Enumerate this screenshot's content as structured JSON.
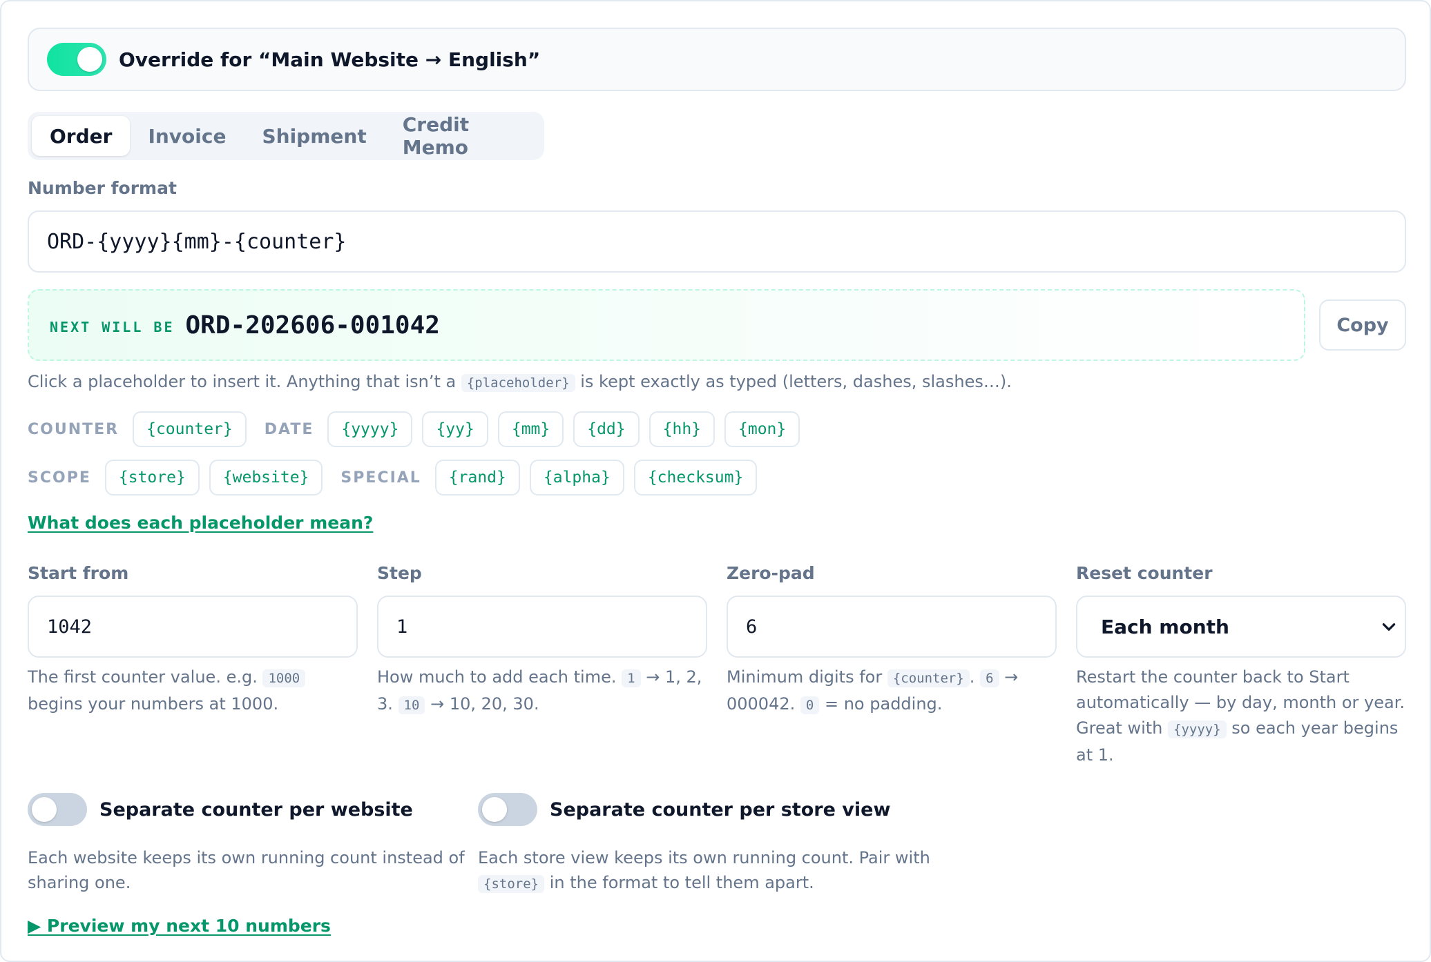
{
  "override": {
    "enabled": true,
    "label": "Override for “Main Website → English”"
  },
  "tabs": [
    {
      "label": "Order",
      "active": true
    },
    {
      "label": "Invoice",
      "active": false
    },
    {
      "label": "Shipment",
      "active": false
    },
    {
      "label": "Credit Memo",
      "active": false
    }
  ],
  "format": {
    "label": "Number format",
    "value": "ORD-{yyyy}{mm}-{counter}"
  },
  "next": {
    "label": "Next will be",
    "value": "ORD-202606-001042",
    "copy_label": "Copy"
  },
  "hint": {
    "before": "Click a placeholder to insert it. Anything that isn’t a",
    "code": "{placeholder}",
    "after": "is kept exactly as typed (letters, dashes, slashes…)."
  },
  "placeholders": {
    "counter_label": "COUNTER",
    "counter": [
      "{counter}"
    ],
    "date_label": "DATE",
    "date": [
      "{yyyy}",
      "{yy}",
      "{mm}",
      "{dd}",
      "{hh}",
      "{mon}"
    ],
    "scope_label": "SCOPE",
    "scope": [
      "{store}",
      "{website}"
    ],
    "special_label": "SPECIAL",
    "special": [
      "{rand}",
      "{alpha}",
      "{checksum}"
    ]
  },
  "help_link": "What does each placeholder mean?",
  "settings": {
    "start": {
      "label": "Start from",
      "value": "1042",
      "help_1": "The first counter value. e.g.",
      "help_code": "1000",
      "help_2": "begins your numbers at 1000."
    },
    "step": {
      "label": "Step",
      "value": "1",
      "help_1": "How much to add each time.",
      "code_a": "1",
      "help_2": "→ 1, 2, 3.",
      "code_b": "10",
      "help_3": "→ 10, 20, 30."
    },
    "zeropad": {
      "label": "Zero-pad",
      "value": "6",
      "help_1": "Minimum digits for",
      "code_a": "{counter}",
      "help_2": ".",
      "code_b": "6",
      "help_3": "→ 000042.",
      "code_c": "0",
      "help_4": "= no padding."
    },
    "reset": {
      "label": "Reset counter",
      "value": "Each month",
      "help_1": "Restart the counter back to Start automatically — by day, month or year. Great with",
      "help_code": "{yyyy}",
      "help_2": "so each year begins at 1."
    }
  },
  "toggles": {
    "per_website": {
      "enabled": false,
      "label": "Separate counter per website",
      "help": "Each website keeps its own running count instead of sharing one."
    },
    "per_store_view": {
      "enabled": false,
      "label": "Separate counter per store view",
      "help_1": "Each store view keeps its own running count. Pair with",
      "help_code": "{store}",
      "help_2": "in the format to tell them apart."
    }
  },
  "preview_link": "▶ Preview my next 10 numbers"
}
